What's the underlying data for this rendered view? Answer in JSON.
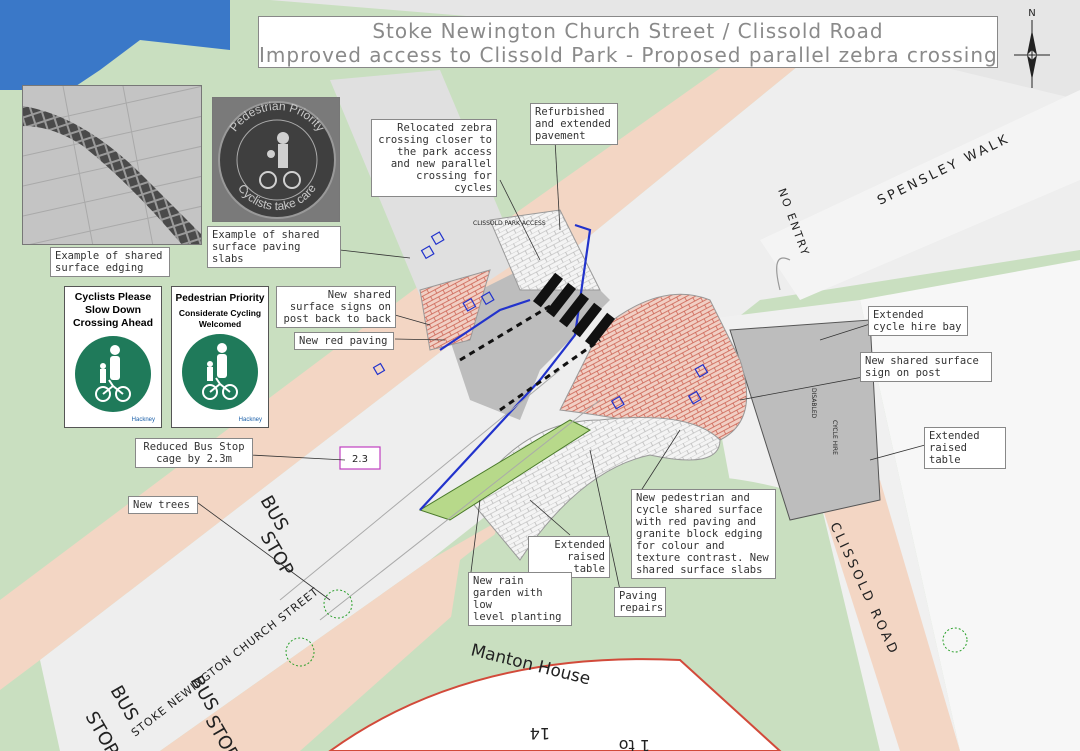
{
  "title": {
    "line1": "Stoke Newington Church Street / Clissold Road",
    "line2": "Improved access to Clissold Park - Proposed parallel zebra crossing"
  },
  "compass": {
    "label": "N"
  },
  "callouts": {
    "shared_edging": "Example of shared\nsurface edging",
    "shared_slabs": "Example of shared\nsurface paving slabs",
    "relocated_zebra": "Relocated zebra\ncrossing closer to\nthe park access\nand new parallel\ncrossing for cycles",
    "refurbished_pavement": "Refurbished\nand extended\npavement",
    "new_signs_back": "New shared\nsurface signs on\npost back to back",
    "new_red_paving": "New red paving",
    "extended_cycle_hire": "Extended\ncycle hire bay",
    "new_sign_on_post": "New shared surface\nsign on post",
    "extended_raised_table_right": "Extended\nraised table",
    "reduced_bus_stop": "Reduced Bus Stop\ncage by 2.3m",
    "new_trees": "New trees",
    "shared_surface_desc": "New pedestrian and\ncycle shared surface\nwith red paving and\ngranite block edging\nfor colour and\ntexture contrast. New\nshared surface slabs",
    "extended_raised_table_mid": "Extended\nraised table",
    "rain_garden": "New rain\ngarden with low\nlevel planting",
    "paving_repairs": "Paving\nrepairs"
  },
  "photo_disc": {
    "top_text": "Pedestrian Priority",
    "bottom_text": "Cyclists take care"
  },
  "signs": {
    "cyclists": {
      "title": "Cyclists Please\nSlow Down\nCrossing Ahead",
      "footer": "Hackney"
    },
    "pedestrian": {
      "title": "Pedestrian Priority",
      "subtitle": "Considerate Cycling\nWelcomed",
      "footer": "Hackney"
    }
  },
  "map_labels": {
    "spensley_walk": "SPENSLEY WALK",
    "no_entry": "NO ENTRY",
    "clissold_road": "CLISSOLD ROAD",
    "church_street": "STOKE NEWINGTON CHURCH STREET",
    "manton_house": "Manton House",
    "bus_stop_1": "BUS",
    "bus_stop_2": "STOP",
    "bus_stop_3": "BUS",
    "bus_stop_4": "STOP",
    "bus_stop_5": "BUS",
    "bus_stop_6": "STOP",
    "dimension": "2.3",
    "clissold_park_access": "CLISSOLD PARK ACCESS",
    "flat_14": "14",
    "flat_1to": "1 to",
    "disabled": "DISABLED",
    "cycle_hire": "CYCLE HIRE"
  },
  "colors": {
    "grass": "#c9dfc0",
    "footway": "#f3d6c4",
    "carriageway": "#e9e9e9",
    "red_paving": "#e8a898",
    "rain_garden": "#b7d98a",
    "water": "#3a78c8",
    "blue_line": "#2233cc",
    "sign_green": "#1f7a5a"
  }
}
